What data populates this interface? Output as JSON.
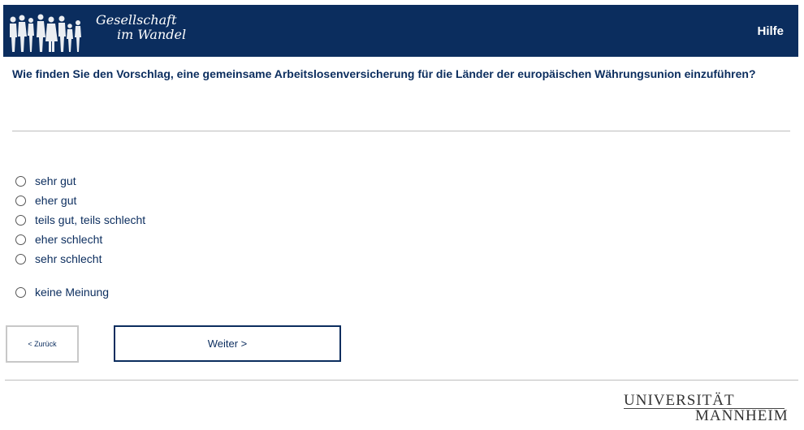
{
  "header": {
    "logo_line1": "Gesellschaft",
    "logo_line2": "im Wandel",
    "help_label": "Hilfe",
    "background_color": "#0b2d5e",
    "logo_icon": "people-silhouettes-icon"
  },
  "question": {
    "text": "Wie finden Sie den Vorschlag, eine gemeinsame Arbeitslosenversicherung für die Länder der europäischen Währungsunion einzuführen?"
  },
  "options": [
    {
      "label": "sehr gut",
      "selected": false
    },
    {
      "label": "eher gut",
      "selected": false
    },
    {
      "label": "teils gut, teils schlecht",
      "selected": false
    },
    {
      "label": "eher schlecht",
      "selected": false
    },
    {
      "label": "sehr schlecht",
      "selected": false
    },
    {
      "label": "keine Meinung",
      "selected": false
    }
  ],
  "navigation": {
    "back_label": "< Zurück",
    "next_label": "Weiter >"
  },
  "footer": {
    "university_line1": "UNIVERSITÄT",
    "university_line2": "MANNHEIM"
  },
  "colors": {
    "accent": "#0b2d5e",
    "text": "#0b2d5e",
    "divider": "#bdbdbd"
  }
}
